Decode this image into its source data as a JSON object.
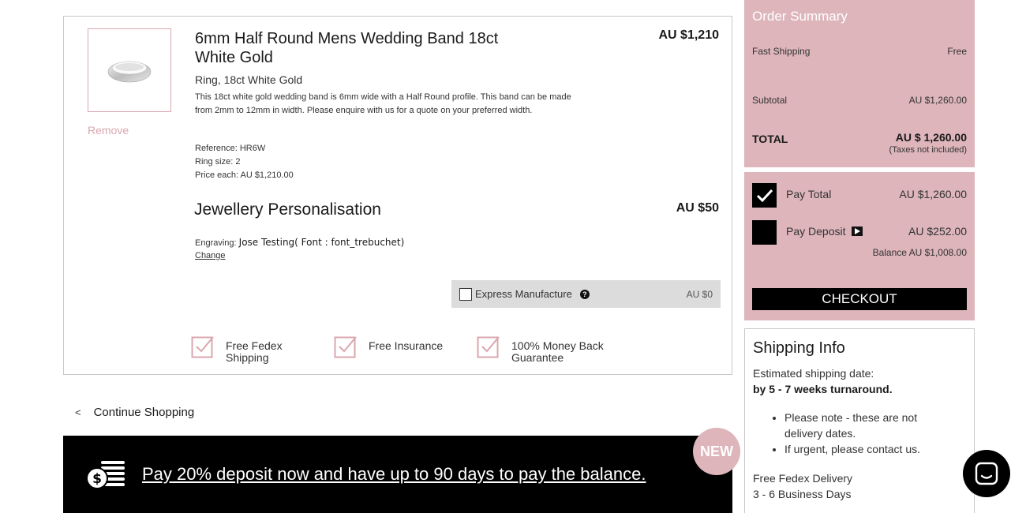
{
  "item": {
    "title": "6mm Half Round Mens Wedding Band 18ct White Gold",
    "price": "AU $1,210",
    "remove_label": "Remove",
    "subtitle": "Ring, 18ct White Gold",
    "description": "This 18ct white gold wedding band is 6mm wide with a Half Round profile. This band can be made from 2mm to 12mm in width. Please enquire with us for a quote on your preferred width.",
    "reference": "Reference: HR6W",
    "ring_size": "Ring size: 2",
    "price_each": "Price each: AU $1,210.00",
    "image_icon": "ring-image"
  },
  "personalisation": {
    "title": "Jewellery Personalisation",
    "price": "AU $50",
    "engraving_label": "Engraving:",
    "engraving_value": "Jose Testing( Font : font_trebuchet)",
    "change_label": "Change"
  },
  "express": {
    "label": "Express Manufacture",
    "price": "AU $0",
    "checked": false
  },
  "perks": [
    {
      "label": "Free Fedex Shipping",
      "icon": "check-box-icon"
    },
    {
      "label": "Free Insurance",
      "icon": "check-box-icon"
    },
    {
      "label": "100% Money Back Guarantee",
      "icon": "check-box-icon"
    }
  ],
  "continue_label": "Continue Shopping",
  "promo": {
    "text": "Pay 20% deposit now and have up to 90 days to pay the balance.",
    "badge": "NEW",
    "icon": "money-coin-icon"
  },
  "summary": {
    "title": "Order Summary",
    "shipping_label": "Fast Shipping",
    "shipping_value": "Free",
    "subtotal_label": "Subtotal",
    "subtotal_value": "AU $1,260.00",
    "total_label": "TOTAL",
    "total_value": "AU $ 1,260.00",
    "tax_note": "(Taxes not included)"
  },
  "payment": {
    "pay_total_label": "Pay Total",
    "pay_total_amount": "AU $1,260.00",
    "pay_total_selected": true,
    "pay_deposit_label": "Pay Deposit",
    "pay_deposit_amount": "AU $252.00",
    "pay_deposit_selected": false,
    "balance": "Balance AU $1,008.00",
    "checkout_label": "CHECKOUT"
  },
  "shipping_info": {
    "title": "Shipping Info",
    "estimated_label": "Estimated shipping date:",
    "turnaround": "by 5 - 7 weeks turnaround.",
    "notes": [
      "Please note - these are not delivery dates.",
      "If urgent, please contact us."
    ],
    "delivery_label": "Free Fedex Delivery",
    "delivery_days": "3 - 6 Business Days"
  },
  "colors": {
    "accent_pink": "#ddb5bb",
    "remove_pink": "#d9a7af",
    "black": "#000000",
    "express_bg": "#dcdcdc"
  }
}
